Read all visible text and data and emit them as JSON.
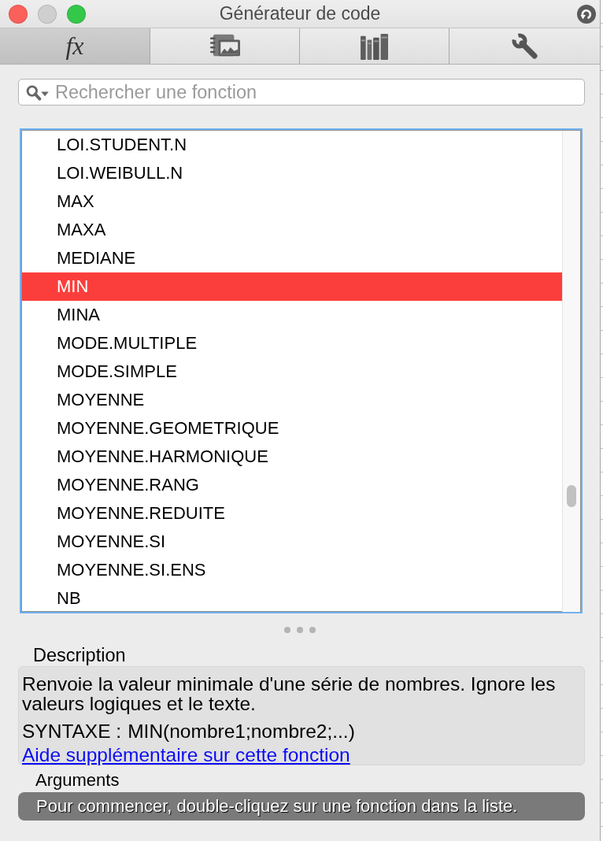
{
  "window": {
    "title": "Générateur de code",
    "controls": [
      {
        "kind": "close",
        "disabled": false
      },
      {
        "kind": "minimize",
        "disabled": true
      },
      {
        "kind": "zoom",
        "disabled": false
      }
    ]
  },
  "toolbar": {
    "tabs": [
      {
        "kind": "label",
        "label": "fx",
        "selected": true
      },
      {
        "kind": "media",
        "selected": false
      },
      {
        "kind": "books",
        "selected": false
      },
      {
        "kind": "wrench",
        "selected": false
      }
    ]
  },
  "search": {
    "placeholder": "Rechercher une fonction"
  },
  "function_list": {
    "items": [
      {
        "name": "LOI.STUDENT.N",
        "selected": false
      },
      {
        "name": "LOI.WEIBULL.N",
        "selected": false
      },
      {
        "name": "MAX",
        "selected": false
      },
      {
        "name": "MAXA",
        "selected": false
      },
      {
        "name": "MEDIANE",
        "selected": false
      },
      {
        "name": "MIN",
        "selected": true
      },
      {
        "name": "MINA",
        "selected": false
      },
      {
        "name": "MODE.MULTIPLE",
        "selected": false
      },
      {
        "name": "MODE.SIMPLE",
        "selected": false
      },
      {
        "name": "MOYENNE",
        "selected": false
      },
      {
        "name": "MOYENNE.GEOMETRIQUE",
        "selected": false
      },
      {
        "name": "MOYENNE.HARMONIQUE",
        "selected": false
      },
      {
        "name": "MOYENNE.RANG",
        "selected": false
      },
      {
        "name": "MOYENNE.REDUITE",
        "selected": false
      },
      {
        "name": "MOYENNE.SI",
        "selected": false
      },
      {
        "name": "MOYENNE.SI.ENS",
        "selected": false
      },
      {
        "name": "NB",
        "selected": false
      }
    ]
  },
  "description": {
    "heading": "Description",
    "text": "Renvoie la valeur minimale d'une série de nombres. Ignore les valeurs logiques et le texte.",
    "syntax_label": "SYNTAXE :",
    "syntax": "MIN(nombre1;nombre2;...)",
    "help_link": "Aide supplémentaire sur cette fonction"
  },
  "arguments": {
    "heading": "Arguments",
    "message": "Pour commencer, double-cliquez sur une fonction dans la liste."
  }
}
